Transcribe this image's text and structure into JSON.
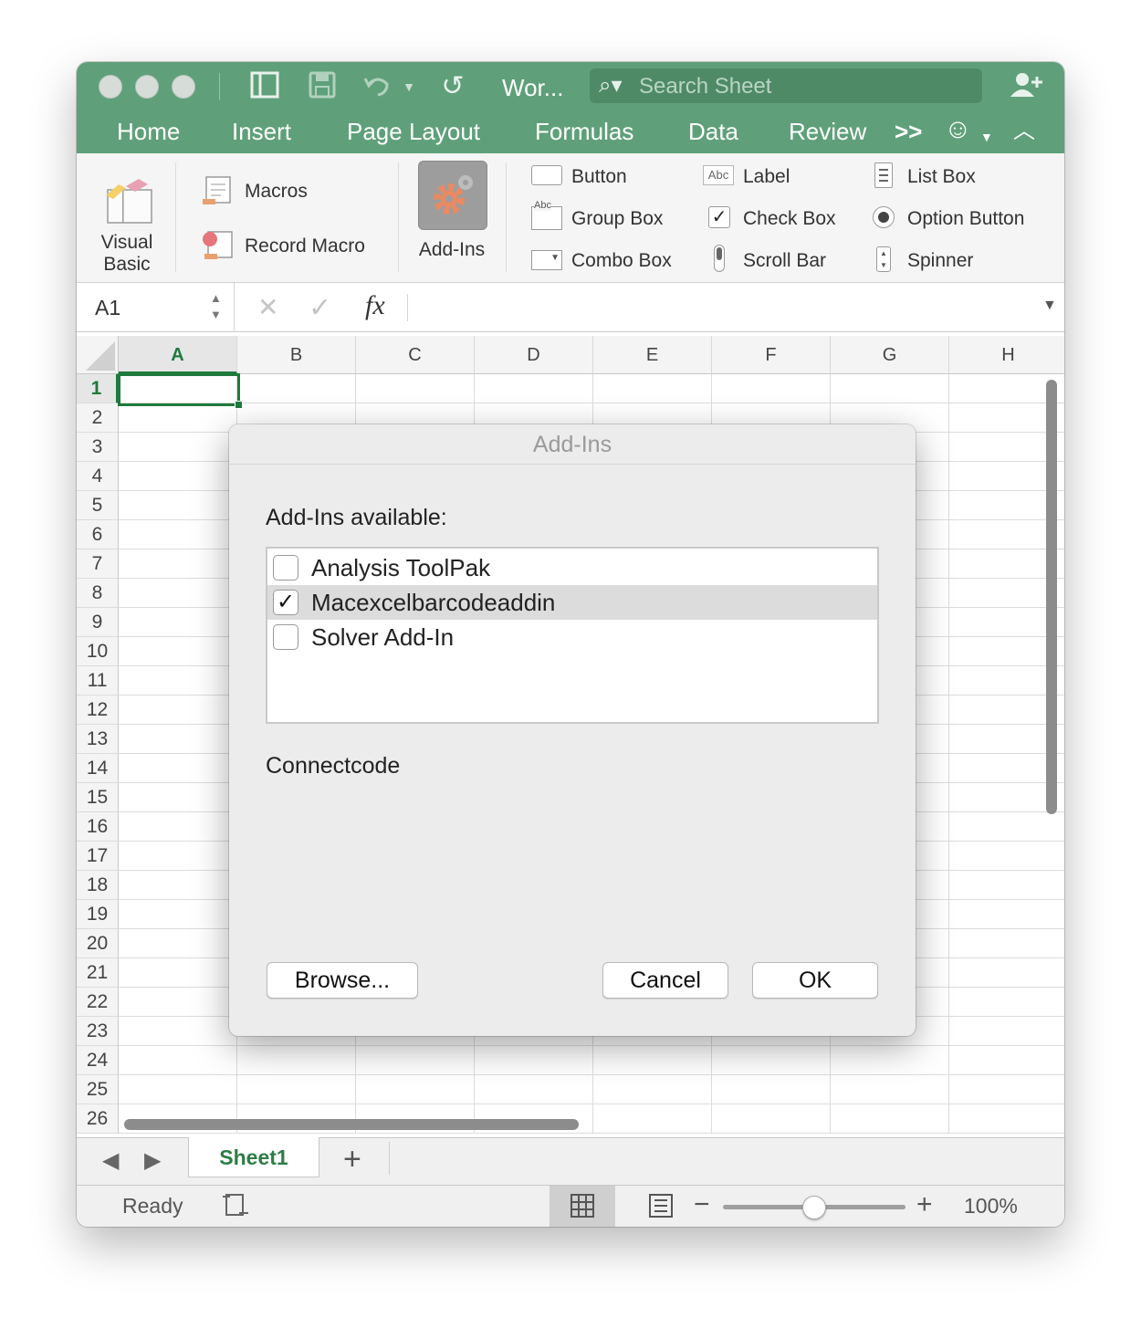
{
  "titlebar": {
    "doc_title": "Wor...",
    "search_placeholder": "Search Sheet",
    "tabs": [
      "Home",
      "Insert",
      "Page Layout",
      "Formulas",
      "Data",
      "Review"
    ],
    "overflow_label": ">>"
  },
  "ribbon": {
    "visual_basic": "Visual Basic",
    "visual_basic_line1": "Visual",
    "visual_basic_line2": "Basic",
    "macros": "Macros",
    "record_macro": "Record Macro",
    "addins": "Add-Ins",
    "controls": {
      "button": "Button",
      "label": "Label",
      "label_icon_text": "Abc",
      "list_box": "List Box",
      "group_box": "Group Box",
      "group_box_icon_text": "Abc",
      "check_box": "Check Box",
      "option_button": "Option Button",
      "combo_box": "Combo Box",
      "scroll_bar": "Scroll Bar",
      "spinner": "Spinner"
    }
  },
  "formula_bar": {
    "name_box": "A1",
    "fx": "fx",
    "cancel_glyph": "✕",
    "enter_glyph": "✓"
  },
  "grid": {
    "columns": [
      "A",
      "B",
      "C",
      "D",
      "E",
      "F",
      "G",
      "H"
    ],
    "rows": [
      "1",
      "2",
      "3",
      "4",
      "5",
      "6",
      "7",
      "8",
      "9",
      "10",
      "11",
      "12",
      "13",
      "14",
      "15",
      "16",
      "17",
      "18",
      "19",
      "20",
      "21",
      "22",
      "23",
      "24",
      "25",
      "26"
    ]
  },
  "sheets": {
    "active": "Sheet1",
    "add_label": "+"
  },
  "status": {
    "ready": "Ready",
    "zoom": "100%",
    "zoom_minus": "−",
    "zoom_plus": "+"
  },
  "dialog": {
    "title": "Add-Ins",
    "available_label": "Add-Ins available:",
    "items": [
      {
        "label": "Analysis ToolPak",
        "checked": false,
        "mark": ""
      },
      {
        "label": "Macexcelbarcodeaddin",
        "checked": true,
        "mark": "✓"
      },
      {
        "label": "Solver Add-In",
        "checked": false,
        "mark": ""
      }
    ],
    "description": "Connectcode",
    "browse": "Browse...",
    "cancel": "Cancel",
    "ok": "OK"
  },
  "colors": {
    "brand_green": "#5fa07a",
    "active_tab_text": "#2d7d46",
    "selection_border": "#1f7a3e"
  }
}
